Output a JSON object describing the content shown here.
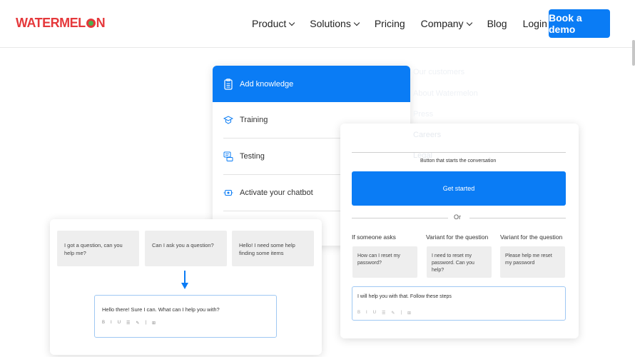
{
  "header": {
    "logo": "WATERMEL",
    "logo_tail": "N",
    "nav": [
      {
        "label": "Product",
        "dropdown": true
      },
      {
        "label": "Solutions",
        "dropdown": true
      },
      {
        "label": "Pricing",
        "dropdown": false
      },
      {
        "label": "Company",
        "dropdown": true
      },
      {
        "label": "Blog",
        "dropdown": false
      }
    ],
    "login": "Login",
    "cta": "Book a demo"
  },
  "company_dropdown": [
    "Our customers",
    "About Watermelon",
    "Press",
    "Careers",
    "Legal"
  ],
  "steps": [
    {
      "label": "Add knowledge",
      "icon": "clipboard-icon",
      "active": true
    },
    {
      "label": "Training",
      "icon": "graduation-cap-icon",
      "active": false
    },
    {
      "label": "Testing",
      "icon": "chat-test-icon",
      "active": false
    },
    {
      "label": "Activate your chatbot",
      "icon": "activate-icon",
      "active": false
    }
  ],
  "builder": {
    "caption": "Button that starts the conversation",
    "button_label": "Get started",
    "or": "Or",
    "columns": [
      {
        "label": "If someone asks",
        "question": "How can I reset my password?"
      },
      {
        "label": "Variant for the question",
        "question": "I need to reset my password. Can you help?"
      },
      {
        "label": "Variant for the question",
        "question": "Please help me reset my password"
      }
    ],
    "answer": "I will help you with that. Follow these steps",
    "toolbar": [
      "B",
      "I",
      "U",
      "☰",
      "✎",
      "|",
      "⊞"
    ]
  },
  "conversation": {
    "questions": [
      "I got a question, can you help me?",
      "Can I ask you a question?",
      "Hello! I need some help finding some items"
    ],
    "answer": "Hello there! Sure I can. What can I help you with?",
    "toolbar": [
      "B",
      "I",
      "U",
      "☰",
      "✎",
      "|",
      "⊞"
    ]
  },
  "colors": {
    "accent": "#0a7cf5",
    "brand": "#e5383b"
  }
}
